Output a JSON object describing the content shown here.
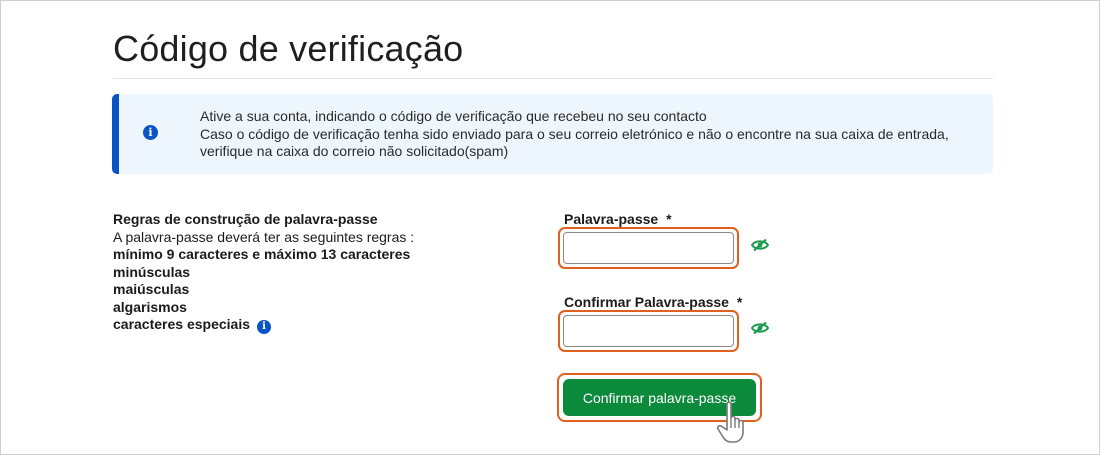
{
  "page": {
    "title": "Código de verificação"
  },
  "info": {
    "line1": "Ative a sua conta, indicando o código de verificação que recebeu no seu contacto",
    "line2": "Caso o código de verificação tenha sido enviado para o seu correio eletrónico e não o encontre na sua caixa de entrada,",
    "line3": "verifique na caixa do correio não solicitado(spam)",
    "icon": "info-circle-icon"
  },
  "rules": {
    "heading": "Regras de construção de palavra-passe",
    "intro": "A palavra-passe deverá ter as seguintes regras :",
    "items": [
      "mínimo 9 caracteres e máximo 13 caracteres",
      "minúsculas",
      "maiúsculas",
      "algarismos",
      "caracteres especiais"
    ]
  },
  "form": {
    "password_label": "Palavra-passe",
    "password_value": "",
    "confirm_label": "Confirmar Palavra-passe",
    "confirm_value": "",
    "required_mark": "*",
    "submit_label": "Confirmar palavra-passe"
  },
  "colors": {
    "accent": "#0a53c4",
    "info_bg": "#eef6fd",
    "button": "#0c8a3c",
    "highlight": "#e0611e",
    "eye_icon": "#1a9b4b"
  }
}
